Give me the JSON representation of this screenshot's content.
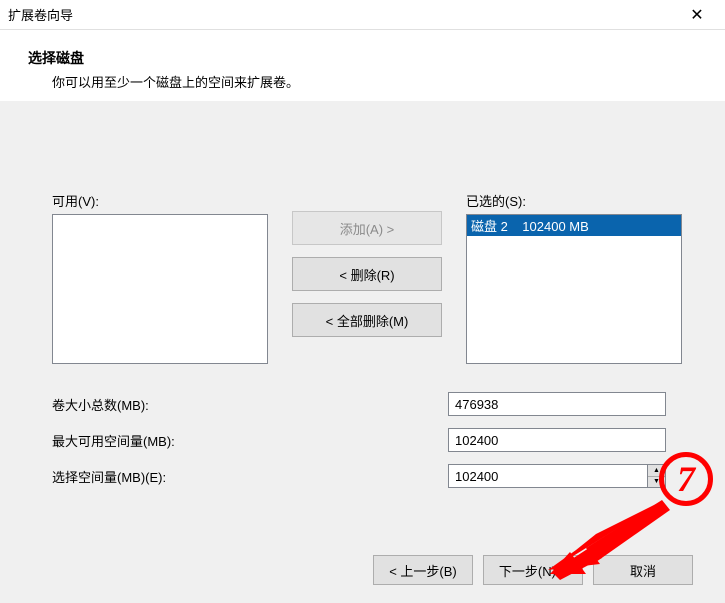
{
  "window": {
    "title": "扩展卷向导"
  },
  "header": {
    "title": "选择磁盘",
    "subtitle": "你可以用至少一个磁盘上的空间来扩展卷。"
  },
  "lists": {
    "available_label": "可用(V):",
    "selected_label": "已选的(S):",
    "selected_items": [
      "磁盘 2    102400 MB"
    ]
  },
  "buttons": {
    "add": "添加(A) >",
    "remove": "< 删除(R)",
    "remove_all": "< 全部删除(M)",
    "back": "< 上一步(B)",
    "next": "下一步(N) >",
    "cancel": "取消"
  },
  "fields": {
    "total_label": "卷大小总数(MB):",
    "total_value": "476938",
    "max_label": "最大可用空间量(MB):",
    "max_value": "102400",
    "select_label": "选择空间量(MB)(E):",
    "select_value": "102400"
  },
  "annotation": {
    "number": "7"
  }
}
